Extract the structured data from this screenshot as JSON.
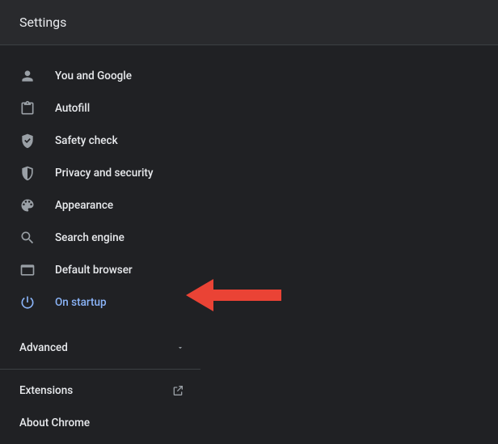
{
  "header": {
    "title": "Settings"
  },
  "nav": {
    "items": [
      {
        "label": "You and Google"
      },
      {
        "label": "Autofill"
      },
      {
        "label": "Safety check"
      },
      {
        "label": "Privacy and security"
      },
      {
        "label": "Appearance"
      },
      {
        "label": "Search engine"
      },
      {
        "label": "Default browser"
      },
      {
        "label": "On startup"
      }
    ]
  },
  "advanced": {
    "label": "Advanced"
  },
  "secondary": {
    "extensions": {
      "label": "Extensions"
    },
    "about": {
      "label": "About Chrome"
    }
  },
  "colors": {
    "accent": "#8ab4f8",
    "arrow": "#ea4335"
  }
}
